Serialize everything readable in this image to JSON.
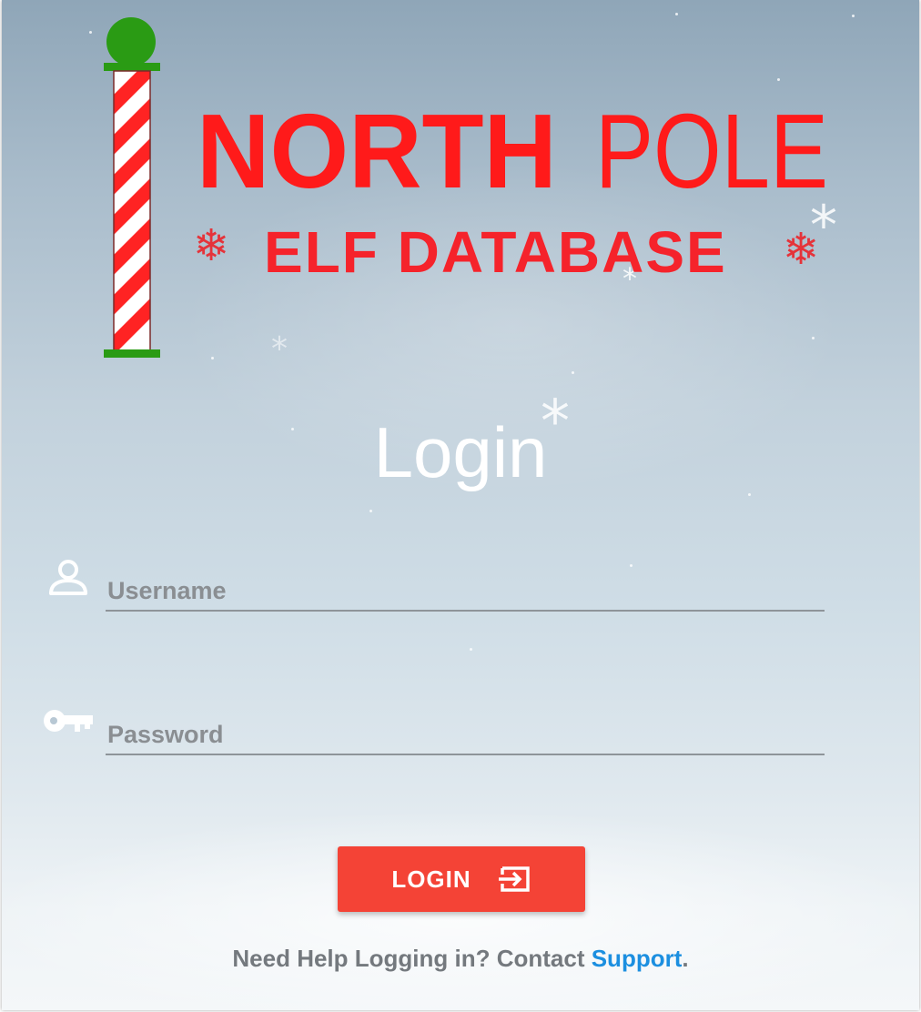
{
  "logo": {
    "word_north": "NORTH",
    "word_pole": "POLE",
    "subtitle": "ELF DATABASE",
    "pole_colors": {
      "cap": "#2a9b14",
      "stripe_red": "#ff2323",
      "stripe_white": "#ffffff"
    }
  },
  "login": {
    "title": "Login",
    "username": {
      "placeholder": "Username",
      "value": "",
      "icon": "person-icon"
    },
    "password": {
      "placeholder": "Password",
      "value": "",
      "icon": "key-icon"
    },
    "button": {
      "label": "LOGIN",
      "icon": "login-icon"
    },
    "help": {
      "prefix": "Need Help Logging in? Contact ",
      "link": "Support",
      "suffix": "."
    }
  },
  "colors": {
    "accent": "#f44336",
    "logo_red": "#ff1a1a",
    "link": "#1c8fe0",
    "pole_green": "#2a9b14"
  }
}
